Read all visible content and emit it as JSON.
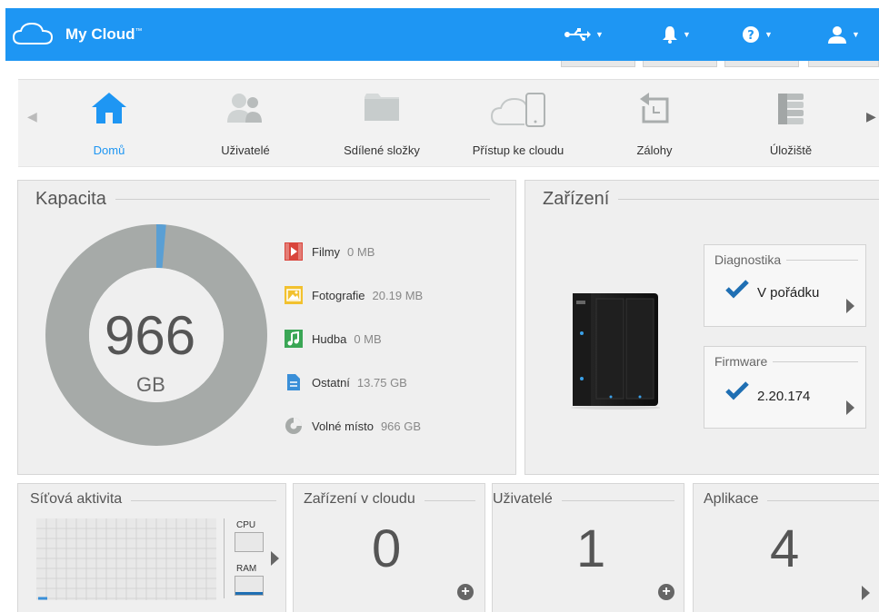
{
  "app": {
    "brand": "My Cloud",
    "tm": "™"
  },
  "topbar": {
    "usb_icon": "usb-icon",
    "bell_icon": "bell-icon",
    "help_icon": "help-icon",
    "user_icon": "user-icon"
  },
  "nav": {
    "items": [
      {
        "label": "Domů",
        "icon": "home-icon",
        "active": true
      },
      {
        "label": "Uživatelé",
        "icon": "users-icon"
      },
      {
        "label": "Sdílené složky",
        "icon": "folder-icon"
      },
      {
        "label": "Přístup ke cloudu",
        "icon": "cloud-device-icon"
      },
      {
        "label": "Zálohy",
        "icon": "backup-icon"
      },
      {
        "label": "Úložiště",
        "icon": "storage-icon"
      }
    ]
  },
  "capacity": {
    "title": "Kapacita",
    "total_value": "966",
    "total_unit": "GB",
    "used_fraction": 0.014,
    "legend": [
      {
        "label": "Filmy",
        "value": "0 MB",
        "icon": "film-icon",
        "color": "#d9453c"
      },
      {
        "label": "Fotografie",
        "value": "20.19 MB",
        "icon": "photo-icon",
        "color": "#f2c12e"
      },
      {
        "label": "Hudba",
        "value": "0 MB",
        "icon": "music-icon",
        "color": "#3aa655"
      },
      {
        "label": "Ostatní",
        "value": "13.75 GB",
        "icon": "document-icon",
        "color": "#3a8fd8"
      },
      {
        "label": "Volné místo",
        "value": "966 GB",
        "icon": "pie-icon",
        "color": "#a6aaa8"
      }
    ]
  },
  "device": {
    "title": "Zařízení",
    "diagnostics": {
      "title": "Diagnostika",
      "value": "V pořádku"
    },
    "firmware": {
      "title": "Firmware",
      "value": "2.20.174"
    }
  },
  "network": {
    "title": "Síťová aktivita",
    "cpu_label": "CPU",
    "ram_label": "RAM"
  },
  "cloud_devices": {
    "title": "Zařízení v cloudu",
    "value": "0"
  },
  "users": {
    "title": "Uživatelé",
    "value": "1"
  },
  "apps": {
    "title": "Aplikace",
    "value": "4"
  },
  "colors": {
    "accent": "#1e96f3",
    "check": "#1f6fb3",
    "donut": "#a6aaa8",
    "donut_used": "#5a9fd4"
  }
}
